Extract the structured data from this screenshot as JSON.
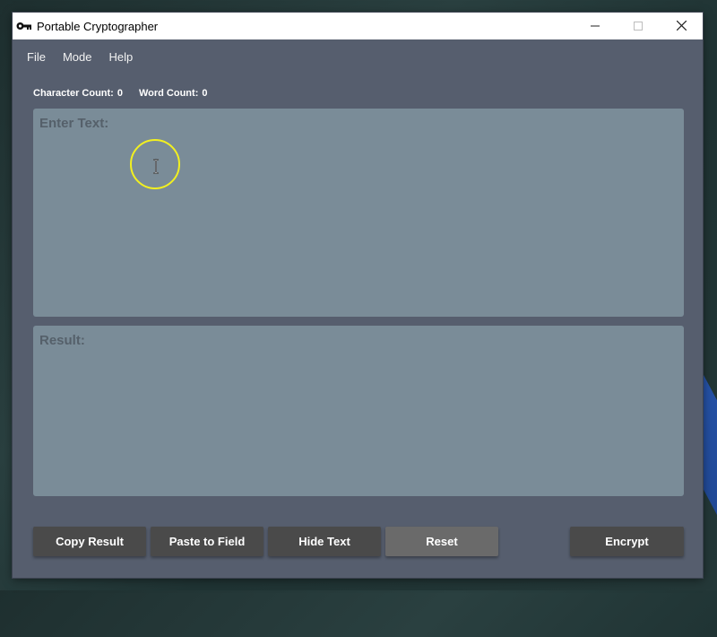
{
  "window": {
    "title": "Portable Cryptographer",
    "icon": "key-icon",
    "controls": [
      "minimize-icon",
      "maximize-icon",
      "close-icon"
    ]
  },
  "menu": {
    "items": [
      "File",
      "Mode",
      "Help"
    ]
  },
  "counts": {
    "character_label": "Character Count:",
    "character_value": "0",
    "word_label": "Word Count:",
    "word_value": "0"
  },
  "input": {
    "label": "Enter Text:",
    "value": ""
  },
  "result": {
    "label": "Result:",
    "value": ""
  },
  "buttons": {
    "copy_result": "Copy Result",
    "paste_to_field": "Paste to Field",
    "hide_text": "Hide Text",
    "reset": "Reset",
    "encrypt": "Encrypt"
  },
  "colors": {
    "window_bg": "#565e6e",
    "text_area_bg": "#7a8c98",
    "button_bg": "#4a4a4a",
    "cursor_highlight": "#f2f020"
  }
}
